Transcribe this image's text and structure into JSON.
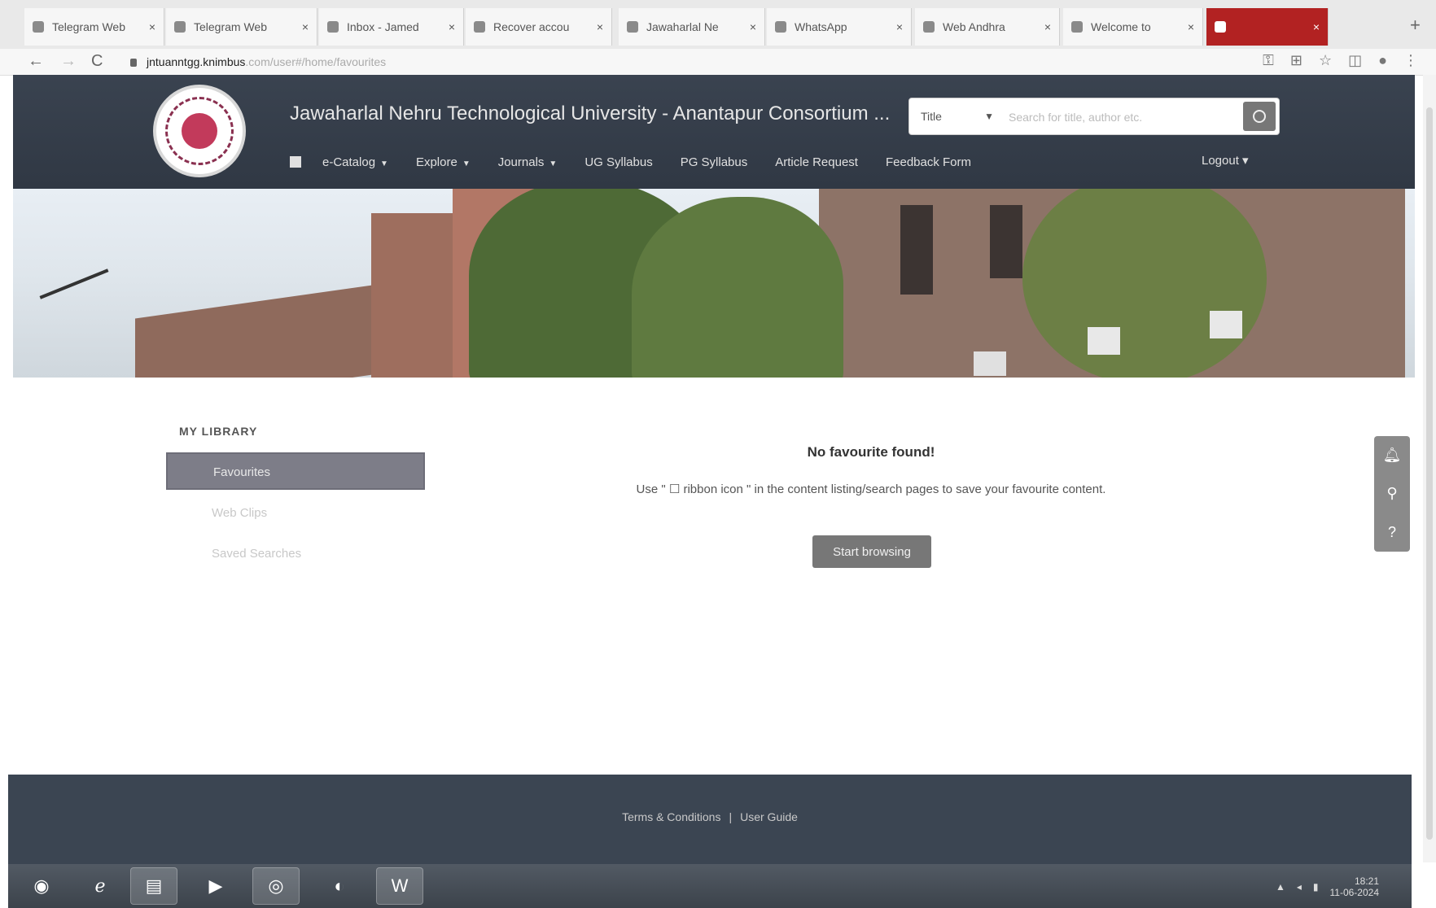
{
  "browser": {
    "tabs": [
      {
        "label": "Telegram Web",
        "active": false
      },
      {
        "label": "Telegram Web",
        "active": false
      },
      {
        "label": "Inbox - Jamed",
        "active": false
      },
      {
        "label": "Recover accou",
        "active": false
      },
      {
        "label": "Jawaharlal Ne",
        "active": false
      },
      {
        "label": "WhatsApp",
        "active": false
      },
      {
        "label": "Web Andhra",
        "active": false
      },
      {
        "label": "Welcome to",
        "active": false
      },
      {
        "label": "",
        "active": true
      }
    ],
    "close_glyph": "×",
    "new_tab_glyph": "+",
    "url_host": "jntuanntgg.knimbus",
    "url_path": ".com/user#/home/favourites",
    "nav": {
      "back": "←",
      "forward": "→",
      "reload": "C"
    }
  },
  "header": {
    "title": "Jawaharlal Nehru Technological University - Anantapur Consortium ...",
    "search": {
      "field_value": "Title",
      "placeholder": "Search for title, author etc."
    },
    "nav": [
      {
        "label": "e-Catalog",
        "dropdown": true
      },
      {
        "label": "Explore",
        "dropdown": true
      },
      {
        "label": "Journals",
        "dropdown": true
      },
      {
        "label": "UG Syllabus",
        "dropdown": false
      },
      {
        "label": "PG Syllabus",
        "dropdown": false
      },
      {
        "label": "Article Request",
        "dropdown": false
      },
      {
        "label": "Feedback Form",
        "dropdown": false
      }
    ],
    "login": "Logout ▾"
  },
  "sidebar": {
    "title": "MY LIBRARY",
    "items": [
      {
        "label": "Favourites",
        "active": true
      },
      {
        "label": "Web Clips",
        "active": false
      },
      {
        "label": "Saved Searches",
        "active": false
      }
    ]
  },
  "main": {
    "empty_title": "No favourite found!",
    "empty_help": "Use \" ☐ ribbon icon \" in the content listing/search pages to save your favourite content.",
    "start_button": "Start browsing"
  },
  "footer": {
    "terms": "Terms & Conditions",
    "separator": "|",
    "guide": "User Guide"
  },
  "taskbar": {
    "clock_time": "18:21",
    "clock_date": "11-06-2024"
  }
}
